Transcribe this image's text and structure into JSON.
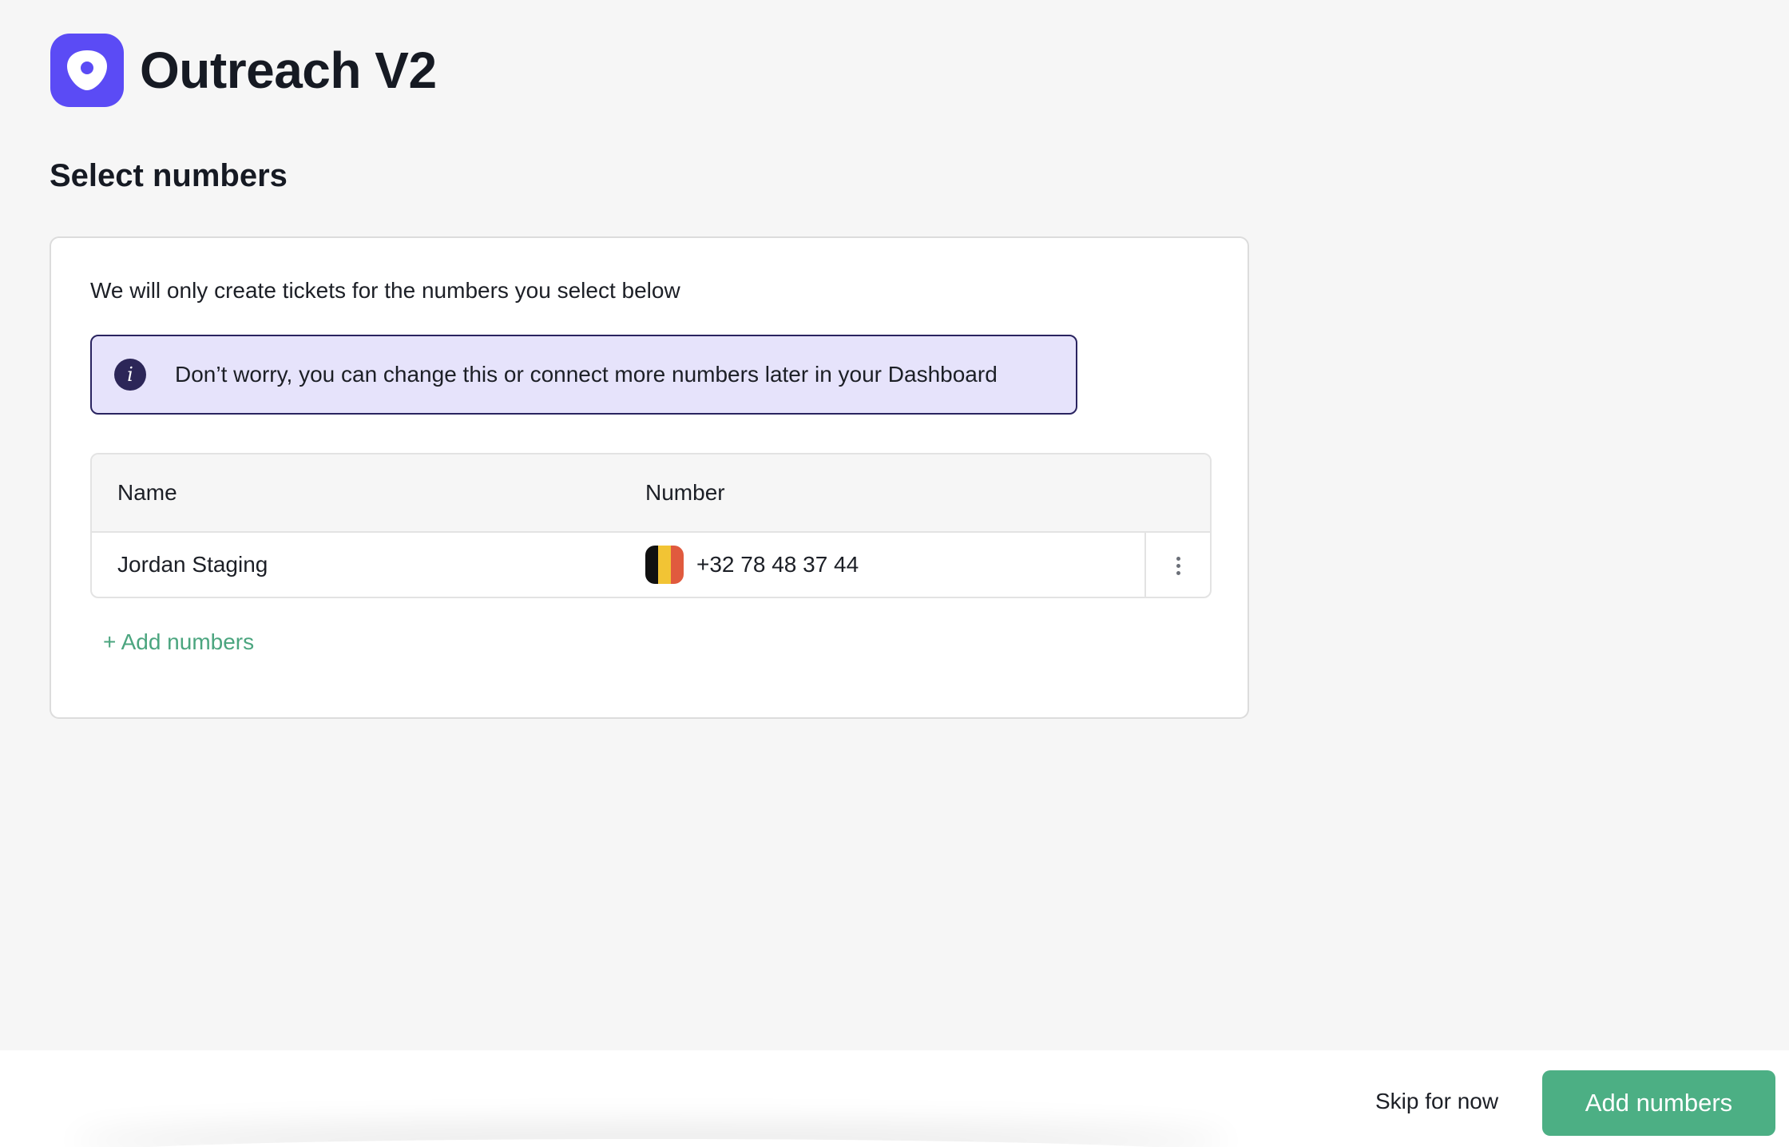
{
  "app": {
    "title": "Outreach V2",
    "logo_icon": "outreach-logo-icon",
    "brand_color": "#5b4bf5"
  },
  "page": {
    "title": "Select numbers"
  },
  "card": {
    "intro": "We will only create tickets for the numbers you select below",
    "info": {
      "icon": "info-icon",
      "glyph": "i",
      "text": "Don’t worry, you can change this or connect more numbers later in your Dashboard"
    },
    "table": {
      "columns": [
        "Name",
        "Number"
      ],
      "rows": [
        {
          "name": "Jordan Staging",
          "flag": "belgium-flag-icon",
          "number": "+32 78 48 37 44",
          "menu_icon": "more-vertical-icon"
        }
      ]
    },
    "add_link": "+ Add numbers"
  },
  "footer": {
    "skip_label": "Skip for now",
    "primary_label": "Add numbers",
    "primary_color": "#4caf84"
  }
}
